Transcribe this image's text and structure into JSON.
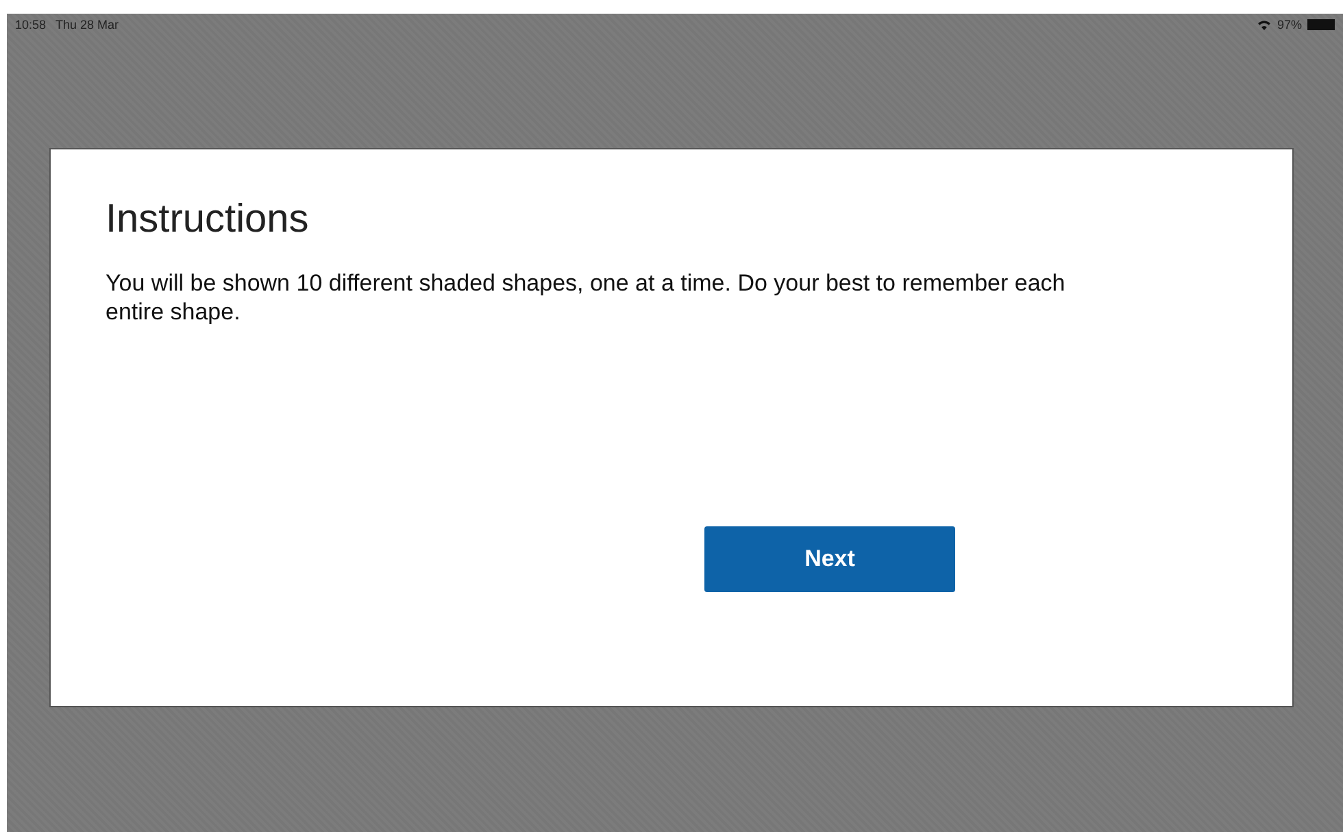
{
  "status_bar": {
    "time": "10:58",
    "date": "Thu 28 Mar",
    "battery": "97%"
  },
  "card": {
    "title": "Instructions",
    "body": "You will be shown 10 different shaded shapes, one at a time. Do your best to remember each entire shape.",
    "button": "Next"
  }
}
